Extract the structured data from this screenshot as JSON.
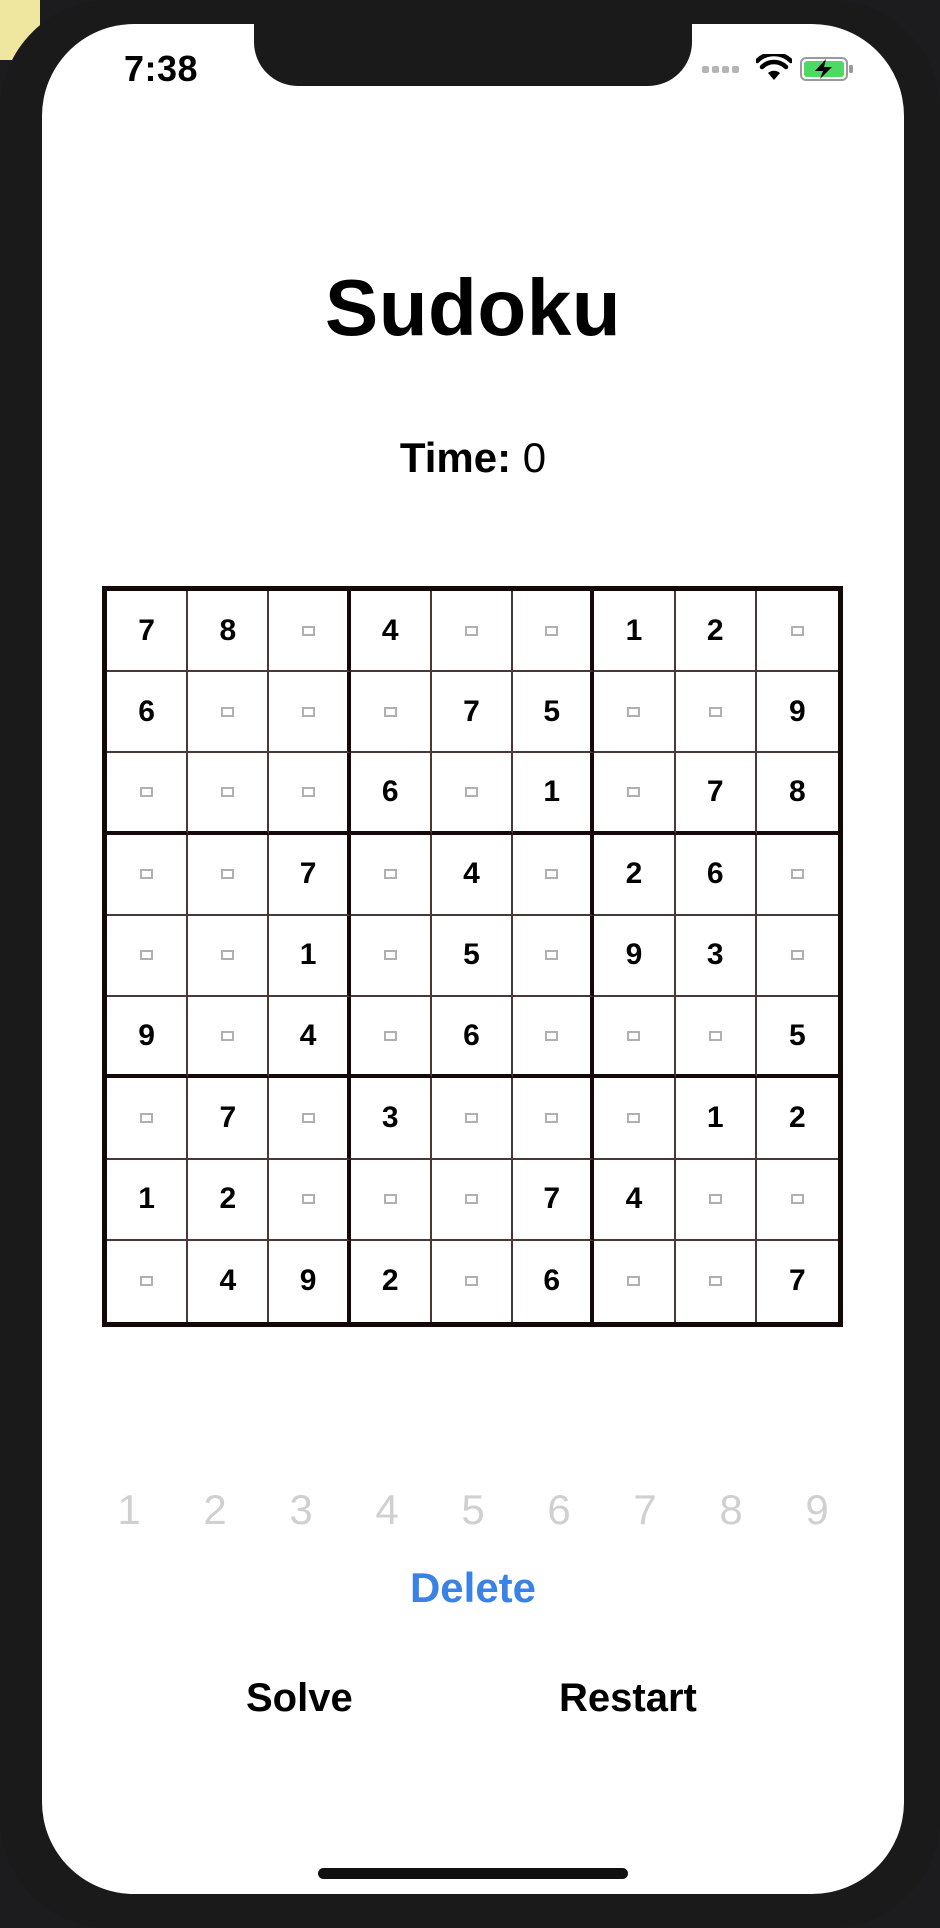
{
  "status_bar": {
    "time": "7:38",
    "icons": [
      "cellular-signal-icon",
      "wifi-icon",
      "battery-charging-icon"
    ],
    "battery_color": "#4cd964"
  },
  "app": {
    "title": "Sudoku",
    "timer_label": "Time:",
    "timer_value": "0"
  },
  "board": {
    "empty_marker": "empty-cell-square",
    "rows": [
      [
        "7",
        "8",
        "",
        "4",
        "",
        "",
        "1",
        "2",
        ""
      ],
      [
        "6",
        "",
        "",
        "",
        "7",
        "5",
        "",
        "",
        "9"
      ],
      [
        "",
        "",
        "",
        "6",
        "",
        "1",
        "",
        "7",
        "8"
      ],
      [
        "",
        "",
        "7",
        "",
        "4",
        "",
        "2",
        "6",
        ""
      ],
      [
        "",
        "",
        "1",
        "",
        "5",
        "",
        "9",
        "3",
        ""
      ],
      [
        "9",
        "",
        "4",
        "",
        "6",
        "",
        "",
        "",
        "5"
      ],
      [
        "",
        "7",
        "",
        "3",
        "",
        "",
        "",
        "1",
        "2"
      ],
      [
        "1",
        "2",
        "",
        "",
        "",
        "7",
        "4",
        "",
        ""
      ],
      [
        "",
        "4",
        "9",
        "2",
        "",
        "6",
        "",
        "",
        "7"
      ]
    ]
  },
  "numpad": {
    "keys": [
      "1",
      "2",
      "3",
      "4",
      "5",
      "6",
      "7",
      "8",
      "9"
    ],
    "color": "#d0d0d0"
  },
  "actions": {
    "delete_label": "Delete",
    "delete_color": "#3b82e6",
    "solve_label": "Solve",
    "restart_label": "Restart"
  }
}
